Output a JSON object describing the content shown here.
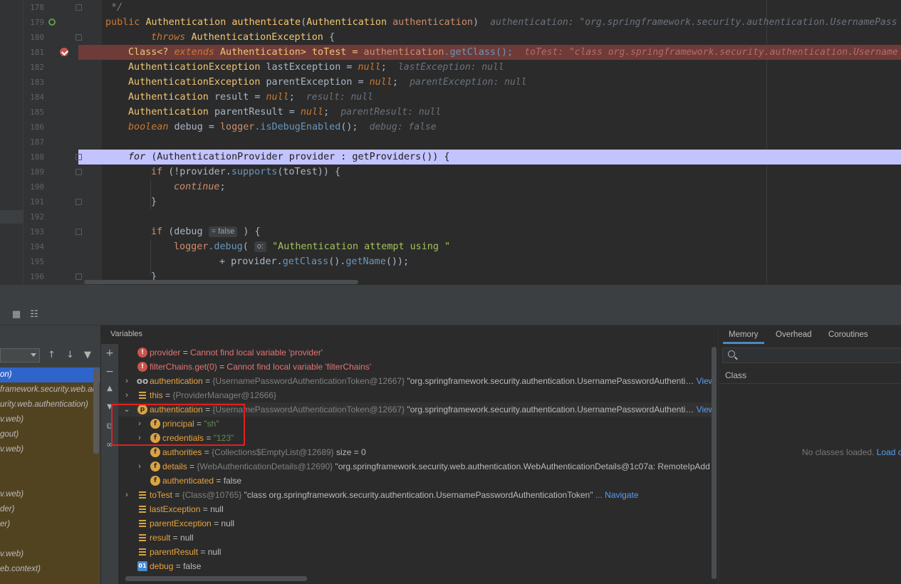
{
  "editor": {
    "lines": [
      {
        "num": "178",
        "text": "*/"
      },
      {
        "num": "179"
      },
      {
        "num": "180"
      },
      {
        "num": "181"
      },
      {
        "num": "182"
      },
      {
        "num": "183"
      },
      {
        "num": "184"
      },
      {
        "num": "185"
      },
      {
        "num": "186"
      },
      {
        "num": "187"
      },
      {
        "num": "188"
      },
      {
        "num": "189"
      },
      {
        "num": "190"
      },
      {
        "num": "191"
      },
      {
        "num": "192"
      },
      {
        "num": "193"
      },
      {
        "num": "194"
      },
      {
        "num": "195"
      },
      {
        "num": "196"
      }
    ],
    "code": {
      "l179_public": "public",
      "l179_type": "Authentication",
      "l179_method": "authenticate",
      "l179_paren": "(",
      "l179_param_type": "Authentication",
      "l179_param": "authentication",
      "l179_close": ")",
      "l179_hint": "authentication: \"org.springframework.security.authentication.UsernamePass",
      "l180_throws": "throws",
      "l180_exc": "AuthenticationException",
      "l180_brace": "{",
      "l181_class": "Class<?",
      "l181_extends": "extends",
      "l181_rest1": "Authentication> toTest =",
      "l181_obj": "authentication",
      "l181_call": ".getClass();",
      "l181_hint": "toTest: \"class org.springframework.security.authentication.Username",
      "l182_type": "AuthenticationException",
      "l182_var": "lastException =",
      "l182_null": "null",
      "l182_semi": ";",
      "l182_hint": "lastException: null",
      "l183_type": "AuthenticationException",
      "l183_var": "parentException =",
      "l183_null": "null",
      "l183_semi": ";",
      "l183_hint": "parentException: null",
      "l184_type": "Authentication",
      "l184_var": "result =",
      "l184_null": "null",
      "l184_semi": ";",
      "l184_hint": "result: null",
      "l185_type": "Authentication",
      "l185_var": "parentResult =",
      "l185_null": "null",
      "l185_semi": ";",
      "l185_hint": "parentResult: null",
      "l186_boolean": "boolean",
      "l186_var": "debug =",
      "l186_logger": "logger",
      "l186_call": ".isDebugEnabled",
      "l186_end": "();",
      "l186_hint": "debug: false",
      "l188_for": "for",
      "l188_rest": "(AuthenticationProvider provider : getProviders()) {",
      "l189_if": "if",
      "l189_a": "(!provider.",
      "l189_supports": "supports",
      "l189_b": "(toTest)) {",
      "l190_continue": "continue",
      "l190_semi": ";",
      "l191_brace": "}",
      "l193_if": "if",
      "l193_a": "(debug",
      "l193_hint": "= false",
      "l193_b": ") {",
      "l194_logger": "logger",
      "l194_debug": ".debug",
      "l194_paren": "(",
      "l194_hint": "o:",
      "l194_str": "\"Authentication attempt using \"",
      "l195_plus": "+ provider.",
      "l195_getclass": "getClass",
      "l195_mid": "().",
      "l195_getname": "getName",
      "l195_end": "());",
      "l196_brace": "}"
    }
  },
  "frames": {
    "items": [
      {
        "label": "on)"
      },
      {
        "label": "framework.security.web.au"
      },
      {
        "label": "urity.web.authentication)"
      },
      {
        "label": "v.web)"
      },
      {
        "label": "gout)"
      },
      {
        "label": "v.web)"
      },
      {
        "label": ""
      },
      {
        "label": ""
      },
      {
        "label": "v.web)"
      },
      {
        "label": "der)"
      },
      {
        "label": "er)"
      },
      {
        "label": ""
      },
      {
        "label": "v.web)"
      },
      {
        "label": "eb.context)"
      }
    ]
  },
  "variables": {
    "title": "Variables",
    "rows": [
      {
        "name": "provider",
        "eq": " = ",
        "value": "Cannot find local variable 'provider'"
      },
      {
        "name": "filterChains.get(0)",
        "eq": " = ",
        "value": "Cannot find local variable 'filterChains'"
      },
      {
        "name": "authentication",
        "eq": " = ",
        "ref": "{UsernamePasswordAuthenticationToken@12667}",
        "value": " \"org.springframework.security.authentication.UsernamePasswordAuthenti…",
        "link": "View"
      },
      {
        "name": "this",
        "eq": " = ",
        "ref": "{ProviderManager@12666}"
      },
      {
        "name": "authentication",
        "eq": " = ",
        "ref": "{UsernamePasswordAuthenticationToken@12667}",
        "value": " \"org.springframework.security.authentication.UsernamePasswordAuthenti…",
        "link": "View"
      },
      {
        "name": "principal",
        "eq": " = ",
        "value": "\"sh\""
      },
      {
        "name": "credentials",
        "eq": " = ",
        "value": "\"123\""
      },
      {
        "name": "authorities",
        "eq": " = ",
        "ref": "{Collections$EmptyList@12689}",
        "value": "  size = 0"
      },
      {
        "name": "details",
        "eq": " = ",
        "ref": "{WebAuthenticationDetails@12690}",
        "value": " \"org.springframework.security.web.authentication.WebAuthenticationDetails@1c07a: RemoteIpAdd"
      },
      {
        "name": "authenticated",
        "eq": " = ",
        "value": "false"
      },
      {
        "name": "toTest",
        "eq": " = ",
        "ref": "{Class@10765}",
        "value": " \"class org.springframework.security.authentication.UsernamePasswordAuthenticationToken\"",
        "link": " ... Navigate"
      },
      {
        "name": "lastException",
        "eq": " = ",
        "value": "null"
      },
      {
        "name": "parentException",
        "eq": " = ",
        "value": "null"
      },
      {
        "name": "result",
        "eq": " = ",
        "value": "null"
      },
      {
        "name": "parentResult",
        "eq": " = ",
        "value": "null"
      },
      {
        "name": "debug",
        "eq": " = ",
        "value": "false"
      }
    ]
  },
  "memory": {
    "tabs": [
      "Memory",
      "Overhead",
      "Coroutines"
    ],
    "column": "Class",
    "empty_text": "No classes loaded.",
    "empty_link": "Load c"
  },
  "icons": {
    "table-icon": "table",
    "layout-icon": "layout",
    "add-icon": "plus",
    "remove-icon": "minus",
    "up-icon": "arrow-up",
    "down-icon": "arrow-down",
    "filter-icon": "filter",
    "search-icon": "magnifier"
  },
  "colors": {
    "breakpoint_line": "#6e3b39",
    "current_line": "#c3c3ff",
    "highlight_box": "#e22020",
    "frame_list_bg": "#524320"
  }
}
